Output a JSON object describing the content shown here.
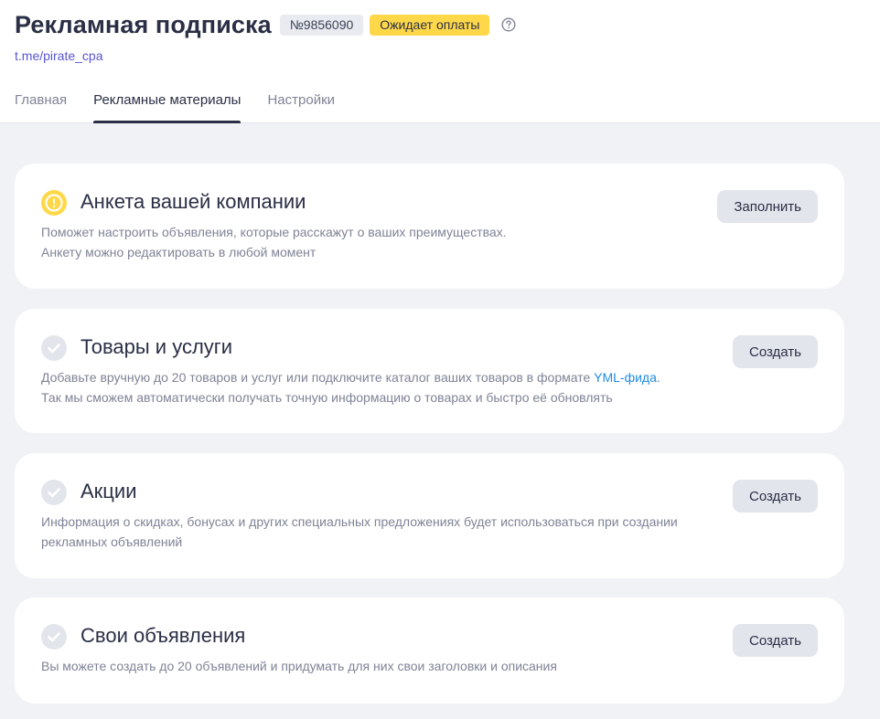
{
  "header": {
    "title": "Рекламная подписка",
    "id_badge": "№9856090",
    "status_badge": "Ожидает оплаты",
    "channel_link": "t.me/pirate_cpa"
  },
  "tabs": [
    {
      "label": "Главная",
      "active": false
    },
    {
      "label": "Рекламные материалы",
      "active": true
    },
    {
      "label": "Настройки",
      "active": false
    }
  ],
  "cards": [
    {
      "icon": "warning-icon",
      "title": "Анкета вашей компании",
      "desc_line1": "Поможет настроить объявления, которые расскажут о ваших преимуществах.",
      "desc_line2": "Анкету можно редактировать в любой момент",
      "button": "Заполнить"
    },
    {
      "icon": "check-icon",
      "title": "Товары и услуги",
      "desc_line1_before": "Добавьте вручную до 20 товаров и услуг или подключите каталог ваших товаров в формате ",
      "desc_line1_link": "YML-фида",
      "desc_line1_after": ".",
      "desc_line2": "Так мы сможем автоматически получать точную информацию о товарах и быстро её обновлять",
      "button": "Создать"
    },
    {
      "icon": "check-icon",
      "title": "Акции",
      "desc_line1": "Информация о скидках, бонусах и других специальных предложениях будет использоваться при создании",
      "desc_line2": "рекламных объявлений",
      "button": "Создать"
    },
    {
      "icon": "check-icon",
      "title": "Свои объявления",
      "desc_line1": "Вы можете создать до 20 объявлений и придумать для них свои заголовки и описания",
      "button": "Создать"
    }
  ],
  "colors": {
    "accent_link": "#5a55d6",
    "status_yellow": "#ffd84a",
    "warning_icon": "#ffd84a",
    "check_icon_bg": "#e3e5ec",
    "yml_link": "#1d8be6",
    "page_bg": "#f1f2f6"
  }
}
